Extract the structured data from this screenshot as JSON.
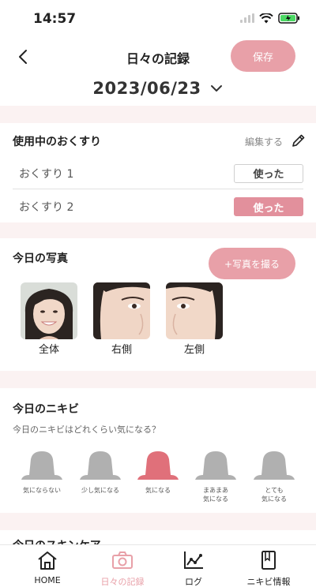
{
  "status_bar": {
    "time": "14:57"
  },
  "header": {
    "title": "日々の記録",
    "save_label": "保存",
    "date": "2023/06/23"
  },
  "medications": {
    "title": "使用中のおくすり",
    "edit_label": "編集する",
    "items": [
      {
        "name": "おくすり 1",
        "button": "使った",
        "state": "unused"
      },
      {
        "name": "おくすり 2",
        "button": "使った",
        "state": "used"
      }
    ]
  },
  "photos": {
    "title": "今日の写真",
    "take_photo_label": "+写真を撮る",
    "items": [
      {
        "label": "全体"
      },
      {
        "label": "右側"
      },
      {
        "label": "左側"
      }
    ]
  },
  "acne": {
    "title": "今日のニキビ",
    "question": "今日のニキビはどれくらい気になる？",
    "levels": [
      {
        "label": "気にならない"
      },
      {
        "label": "少し気になる"
      },
      {
        "label": "気になる"
      },
      {
        "label": "まあまあ\n気になる"
      },
      {
        "label": "とても\n気になる"
      }
    ],
    "selected_index": 2
  },
  "next_section": {
    "title": "今日のスキンケア"
  },
  "tabbar": {
    "items": [
      {
        "label": "HOME",
        "icon": "home-icon"
      },
      {
        "label": "日々の記録",
        "icon": "camera-icon"
      },
      {
        "label": "ログ",
        "icon": "chart-icon"
      },
      {
        "label": "ニキビ情報",
        "icon": "book-icon"
      }
    ],
    "active_index": 1
  },
  "colors": {
    "accent": "#e8a0a8",
    "active_tab": "#e8a0a8",
    "selected_level": "#e0707a",
    "unselected_level": "#b0b0b0"
  }
}
